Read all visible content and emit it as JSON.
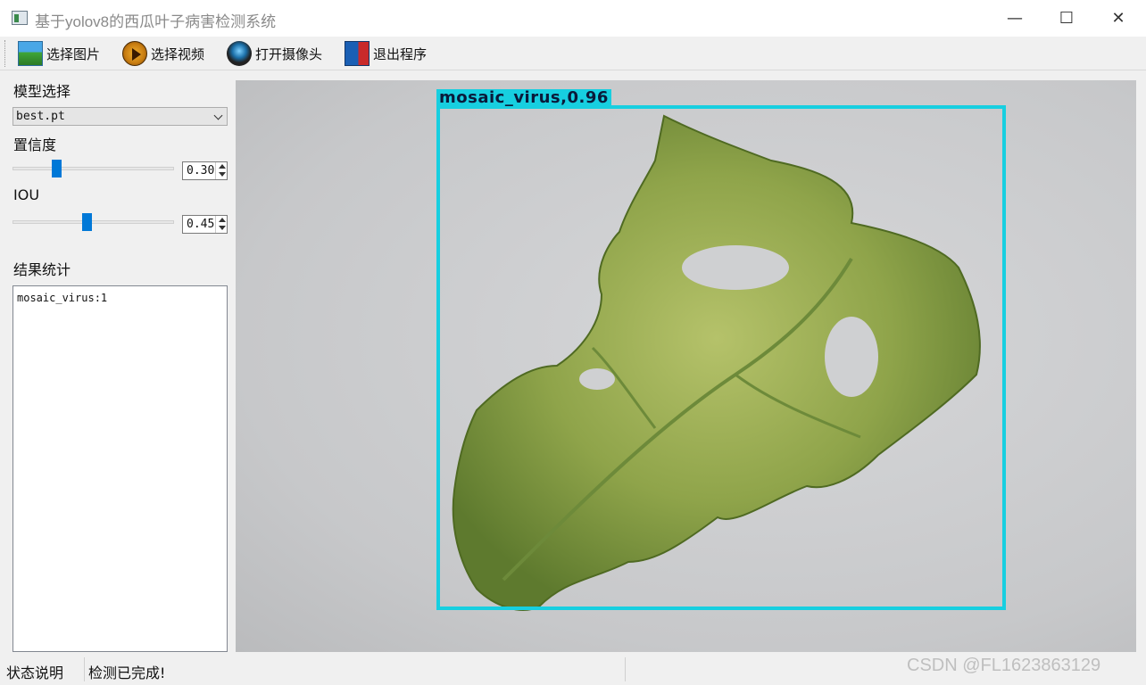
{
  "window": {
    "title": "基于yolov8的西瓜叶子病害检测系统",
    "minimize_glyph": "—",
    "maximize_glyph": "☐",
    "close_glyph": "✕"
  },
  "toolbar": {
    "items": [
      {
        "label": "选择图片",
        "icon": "image-icon"
      },
      {
        "label": "选择视频",
        "icon": "video-play-icon"
      },
      {
        "label": "打开摄像头",
        "icon": "webcam-icon"
      },
      {
        "label": "退出程序",
        "icon": "exit-door-icon"
      }
    ]
  },
  "left_panel": {
    "model_label": "模型选择",
    "model_value": "best.pt",
    "confidence_label": "置信度",
    "confidence_value": "0.30",
    "iou_label": "IOU",
    "iou_value": "0.45",
    "results_label": "结果统计",
    "results_text": "mosaic_virus:1"
  },
  "detection": {
    "label": "mosaic_virus,0.96",
    "box_color": "#17cfe0"
  },
  "statusbar": {
    "title": "状态说明",
    "message": "检测已完成!"
  },
  "watermark": "CSDN @FL1623863129"
}
